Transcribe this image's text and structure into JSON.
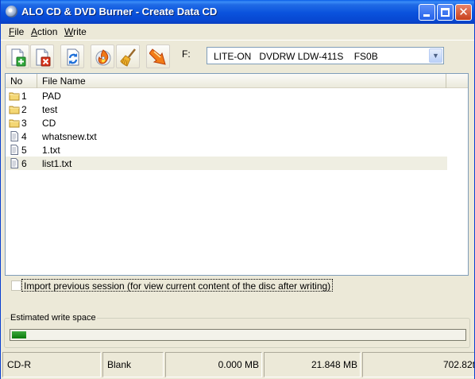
{
  "window": {
    "title": "ALO CD & DVD Burner - Create Data CD"
  },
  "menu": {
    "file": {
      "key": "F",
      "rest": "ile"
    },
    "action": {
      "key": "A",
      "rest": "ction"
    },
    "write": {
      "key": "W",
      "rest": "rite"
    }
  },
  "toolbar": {
    "buttons": [
      "add-files-icon",
      "remove-files-icon",
      "refresh-icon",
      "burn-icon",
      "erase-broom-icon",
      "write-arrow-icon"
    ],
    "drive_letter": "F:",
    "drive_selected": "LITE-ON   DVDRW LDW-411S    FS0B"
  },
  "list": {
    "columns": [
      "No",
      "File Name"
    ],
    "rows": [
      {
        "no": "1",
        "name": "PAD",
        "kind": "folder"
      },
      {
        "no": "2",
        "name": "test",
        "kind": "folder"
      },
      {
        "no": "3",
        "name": "CD",
        "kind": "folder"
      },
      {
        "no": "4",
        "name": "whatsnew.txt",
        "kind": "file"
      },
      {
        "no": "5",
        "name": "1.txt",
        "kind": "file"
      },
      {
        "no": "6",
        "name": "list1.txt",
        "kind": "file",
        "selected": true
      }
    ]
  },
  "import_session": {
    "label": "Import previous session (for view current content of the disc after writing)",
    "checked": false
  },
  "write_space": {
    "title": "Estimated write space",
    "fraction": 0.031
  },
  "status": {
    "media": "CD-R",
    "state": "Blank",
    "used": "0.000 MB",
    "size": "21.848 MB",
    "capacity": "702.82t"
  },
  "colors": {
    "titlebar": "#0a52dc",
    "progress_fill": "#0b7a0b",
    "selection": "#efeee2"
  }
}
